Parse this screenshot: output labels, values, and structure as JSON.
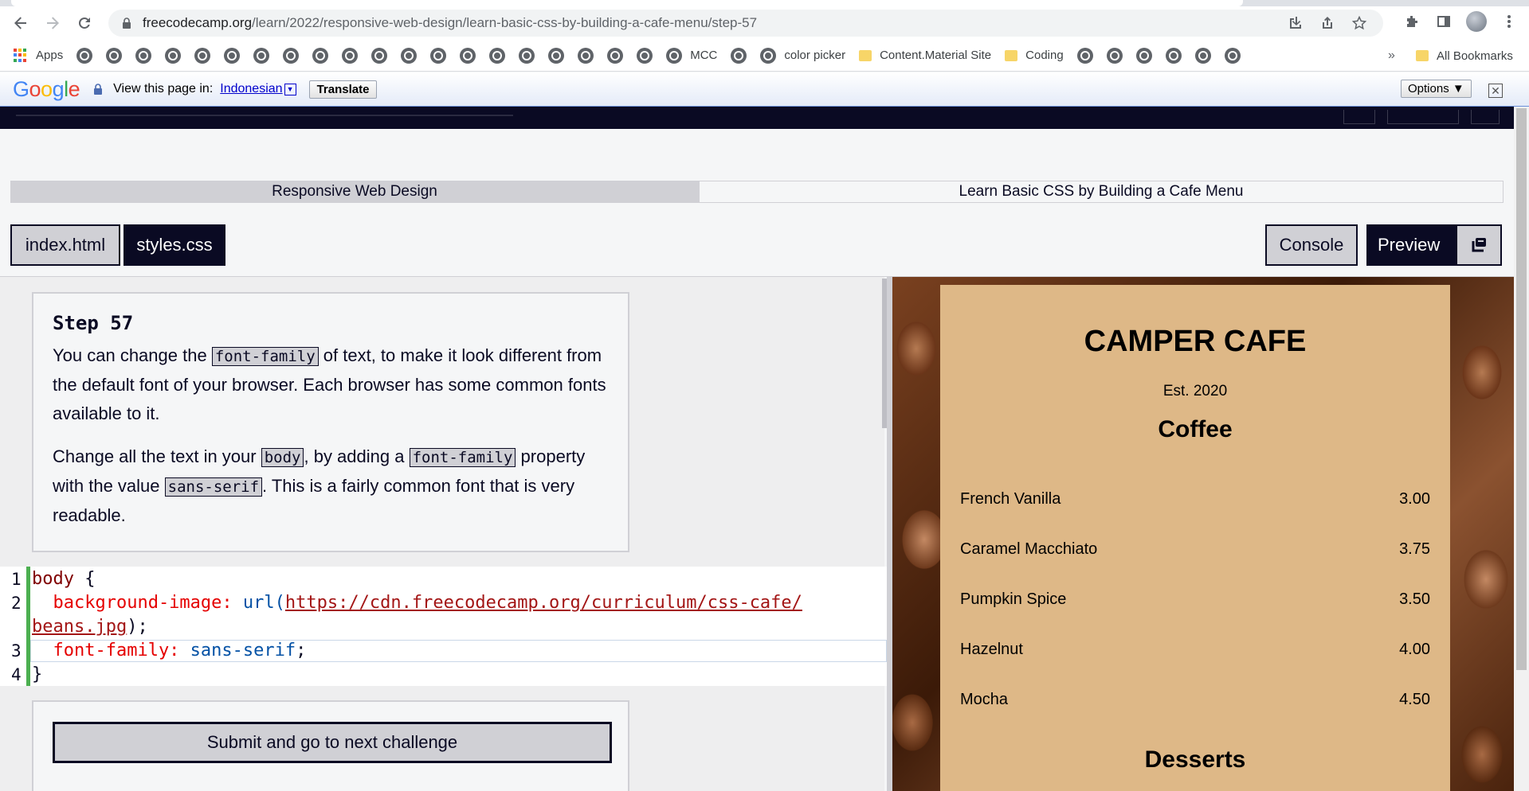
{
  "browser": {
    "url_host": "freecodecamp.org",
    "url_path": "/learn/2022/responsive-web-design/learn-basic-css-by-building-a-cafe-menu/step-57",
    "bookmarks": {
      "apps": "Apps",
      "mcc": "MCC",
      "color_picker": "color picker",
      "content_material": "Content.Material Site",
      "coding": "Coding",
      "more": "»",
      "all": "All Bookmarks"
    }
  },
  "translate_bar": {
    "logo": "Google",
    "view_text": "View this page in:",
    "language": "Indonesian",
    "translate_btn": "Translate",
    "options_btn": "Options ▼",
    "close": "✕"
  },
  "breadcrumb": {
    "superblock": "Responsive Web Design",
    "block": "Learn Basic CSS by Building a Cafe Menu"
  },
  "tabs": {
    "index": "index.html",
    "styles": "styles.css",
    "console": "Console",
    "preview": "Preview"
  },
  "instructions": {
    "title": "Step 57",
    "p1_a": "You can change the ",
    "p1_code": "font-family",
    "p1_b": " of text, to make it look different from the default font of your browser. Each browser has some common fonts available to it.",
    "p2_a": "Change all the text in your ",
    "p2_code1": "body",
    "p2_b": ", by adding a ",
    "p2_code2": "font-family",
    "p2_c": " property with the value ",
    "p2_code3": "sans-serif",
    "p2_d": ". This is a fairly common font that is very readable."
  },
  "editor": {
    "line_numbers": [
      "1",
      "2",
      "3",
      "4"
    ],
    "l1_sel": "body",
    "l1_brace": " {",
    "l2_prop": "  background-image:",
    "l2_func": " url(",
    "l2_url1": "https://cdn.freecodecamp.org/curriculum/css-cafe/",
    "l2b_url2": "beans.jpg",
    "l2b_end": ");",
    "l3_prop": "  font-family:",
    "l3_val": " sans-serif",
    "l3_end": ";",
    "l4": "}"
  },
  "submit": {
    "label": "Submit and go to next challenge"
  },
  "preview": {
    "title": "CAMPER CAFE",
    "est": "Est. 2020",
    "coffee_heading": "Coffee",
    "items": [
      {
        "name": "French Vanilla",
        "price": "3.00"
      },
      {
        "name": "Caramel Macchiato",
        "price": "3.75"
      },
      {
        "name": "Pumpkin Spice",
        "price": "3.50"
      },
      {
        "name": "Hazelnut",
        "price": "4.00"
      },
      {
        "name": "Mocha",
        "price": "4.50"
      }
    ],
    "desserts_heading": "Desserts",
    "menu_bg": "#deb887"
  }
}
